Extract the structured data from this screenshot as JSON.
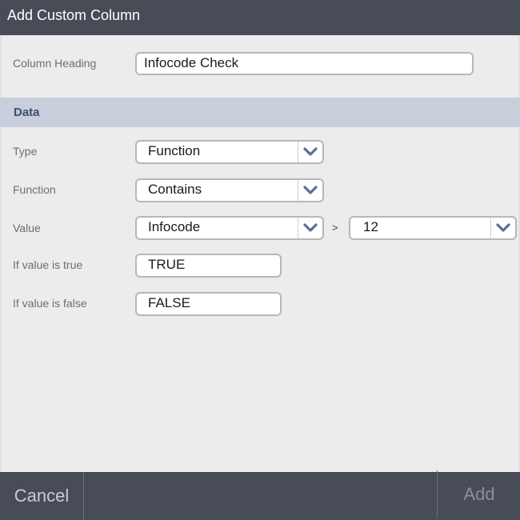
{
  "window": {
    "title": "Add Custom Column"
  },
  "column_heading": {
    "label": "Column Heading",
    "value": "Infocode Check"
  },
  "section": {
    "title": "Data"
  },
  "type": {
    "label": "Type",
    "value": "Function"
  },
  "function": {
    "label": "Function",
    "value": "Contains"
  },
  "value": {
    "label": "Value",
    "field": "Infocode",
    "operator": ">",
    "operand": "12"
  },
  "if_true": {
    "label": "If value is true",
    "value": "TRUE"
  },
  "if_false": {
    "label": "If value is false",
    "value": "FALSE"
  },
  "footer": {
    "cancel": "Cancel",
    "add": "Add"
  },
  "colors": {
    "header_bg": "#474c57",
    "section_bg": "#c7cedc",
    "section_text": "#3d4d70",
    "chevron": "#5b6f96"
  }
}
